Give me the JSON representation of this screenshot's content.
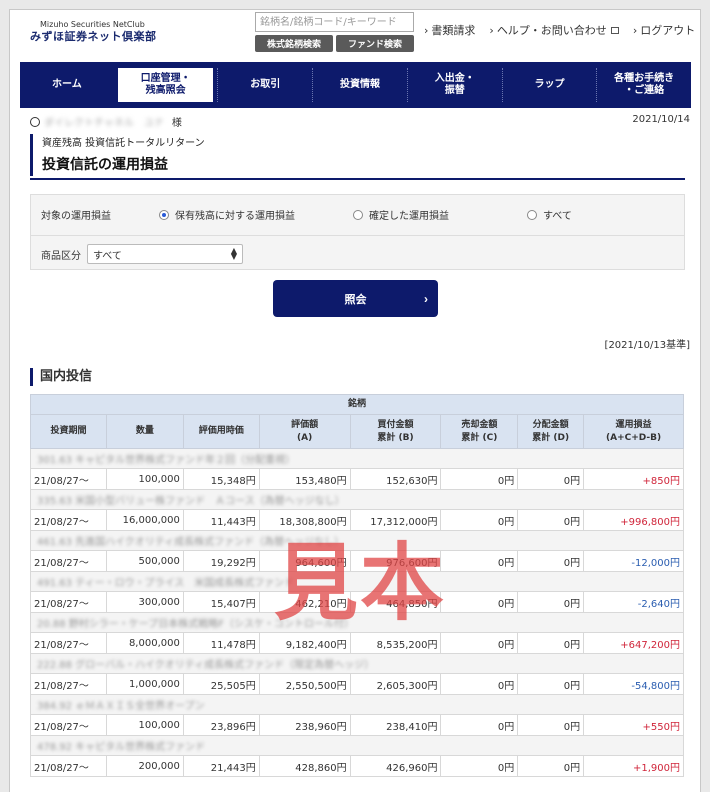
{
  "header": {
    "logo_en": "Mizuho Securities NetClub",
    "logo_jp": "みずほ証券ネット倶楽部",
    "search_placeholder": "銘柄名/銘柄コード/キーワード",
    "btn_stock_search": "株式銘柄検索",
    "btn_fund_search": "ファンド検索",
    "links": [
      "書類請求",
      "ヘルプ・お問い合わせ",
      "ログアウト"
    ]
  },
  "nav": [
    {
      "label": "ホーム",
      "active": false
    },
    {
      "label": "口座管理・\n残高照会",
      "active": true
    },
    {
      "label": "お取引",
      "active": false
    },
    {
      "label": "投資情報",
      "active": false
    },
    {
      "label": "入出金・\n振替",
      "active": false
    },
    {
      "label": "ラップ",
      "active": false
    },
    {
      "label": "各種お手続き\n・ご連絡",
      "active": false
    }
  ],
  "user": {
    "name": "ダイレクトチャネル　ユナ",
    "suffix": "様",
    "date": "2021/10/14"
  },
  "breadcrumb": "資産残高 投資信託トータルリターン",
  "page_title": "投資信託の運用損益",
  "filter": {
    "scope_label": "対象の運用損益",
    "options": [
      "保有残高に対する運用損益",
      "確定した運用損益",
      "すべて"
    ],
    "selected": 0,
    "category_label": "商品区分",
    "category_value": "すべて"
  },
  "submit_label": "照会",
  "basis_date": "[2021/10/13基準]",
  "section_title": "国内投信",
  "table": {
    "group_header": "銘柄",
    "headers": [
      "投資期間",
      "数量",
      "評価用時価",
      "評価額\n(A)",
      "買付金額\n累計 (B)",
      "売却金額\n累計 (C)",
      "分配金額\n累計 (D)",
      "運用損益\n(A+C+D-B)"
    ],
    "rows": [
      {
        "fund": "301.63 キャピタル世界株式ファンド年２回（分配重視）",
        "period": "21/08/27～",
        "qty": "100,000",
        "price": "15,348円",
        "valuation": "153,480円",
        "buy": "152,630円",
        "sell": "0円",
        "dist": "0円",
        "pl": "+850円",
        "sign": "pos"
      },
      {
        "fund": "335.63 米国小型バリュー株ファンド　Ａコース（為替ヘッジなし）",
        "period": "21/08/27～",
        "qty": "16,000,000",
        "price": "11,443円",
        "valuation": "18,308,800円",
        "buy": "17,312,000円",
        "sell": "0円",
        "dist": "0円",
        "pl": "+996,800円",
        "sign": "pos"
      },
      {
        "fund": "461.63 先進国ハイクオリティ成長株式ファンド（為替ヘッジなし）",
        "period": "21/08/27～",
        "qty": "500,000",
        "price": "19,292円",
        "valuation": "964,600円",
        "buy": "976,600円",
        "sell": "0円",
        "dist": "0円",
        "pl": "-12,000円",
        "sign": "neg"
      },
      {
        "fund": "491.63 ティー・ロウ・プライス　米国成長株式ファンド",
        "period": "21/08/27～",
        "qty": "300,000",
        "price": "15,407円",
        "valuation": "462,210円",
        "buy": "464,850円",
        "sell": "0円",
        "dist": "0円",
        "pl": "-2,640円",
        "sign": "neg"
      },
      {
        "fund": "20.88 野村シラー・ケープ日本株式戦略F（シスケ・コントロール付）",
        "period": "21/08/27～",
        "qty": "8,000,000",
        "price": "11,478円",
        "valuation": "9,182,400円",
        "buy": "8,535,200円",
        "sell": "0円",
        "dist": "0円",
        "pl": "+647,200円",
        "sign": "pos"
      },
      {
        "fund": "222.88 グローバル・ハイクオリティ成長株式ファンド（限定為替ヘッジ）",
        "period": "21/08/27～",
        "qty": "1,000,000",
        "price": "25,505円",
        "valuation": "2,550,500円",
        "buy": "2,605,300円",
        "sell": "0円",
        "dist": "0円",
        "pl": "-54,800円",
        "sign": "neg"
      },
      {
        "fund": "384.92 ｅＭＡＸＩＳ全世界オープン",
        "period": "21/08/27～",
        "qty": "100,000",
        "price": "23,896円",
        "valuation": "238,960円",
        "buy": "238,410円",
        "sell": "0円",
        "dist": "0円",
        "pl": "+550円",
        "sign": "pos"
      },
      {
        "fund": "478.92 キャピタル世界株式ファンド",
        "period": "21/08/27～",
        "qty": "200,000",
        "price": "21,443円",
        "valuation": "428,860円",
        "buy": "426,960円",
        "sell": "0円",
        "dist": "0円",
        "pl": "+1,900円",
        "sign": "pos"
      }
    ]
  },
  "watermark": "見本",
  "colors": {
    "nav": "#0d1a6b",
    "positive": "#d0253a",
    "negative": "#2a5db0",
    "header_cell": "#d9e3f1"
  }
}
